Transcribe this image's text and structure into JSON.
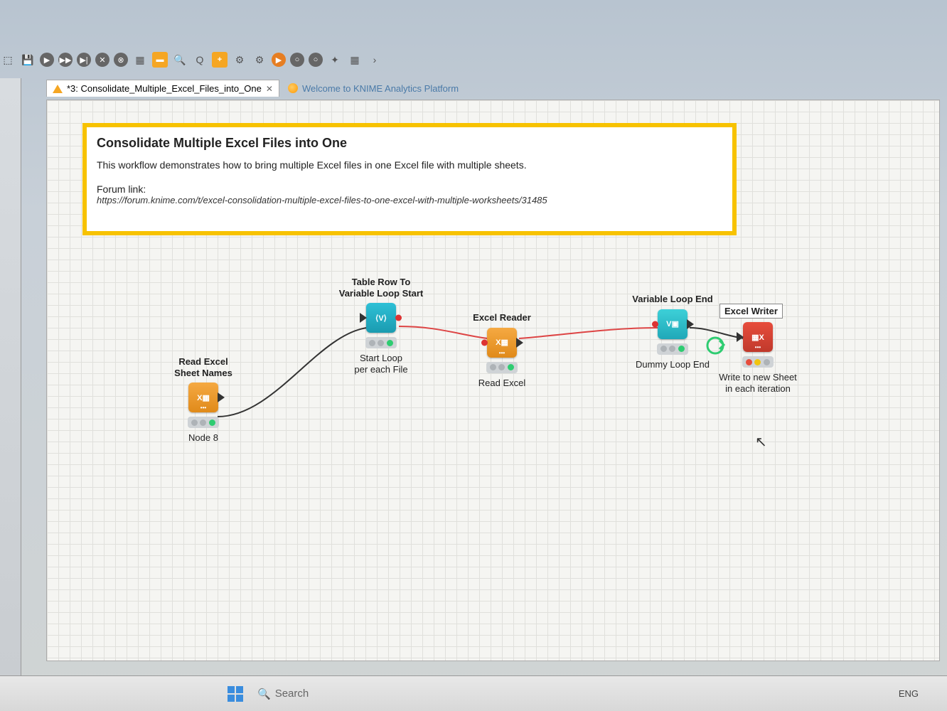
{
  "tabs": {
    "active": "*3: Consolidate_Multiple_Excel_Files_into_One",
    "inactive": "Welcome to KNIME Analytics Platform"
  },
  "annotation": {
    "title": "Consolidate Multiple Excel Files into One",
    "desc": "This workflow demonstrates how to bring multiple Excel files in one Excel file with multiple sheets.",
    "forum_label": "Forum link:",
    "forum_url": "https://forum.knime.com/t/excel-consolidation-multiple-excel-files-to-one-excel-with-multiple-worksheets/31485"
  },
  "free_label": {
    "excel_writer": "Excel Writer"
  },
  "nodes": {
    "read_excel_names": {
      "top_label": "Read Excel\nSheet Names",
      "bottom_label": "Node 8"
    },
    "loop_start": {
      "top_label": "Table Row To\nVariable Loop Start",
      "bottom_label": "Start Loop\nper each File"
    },
    "excel_reader": {
      "top_label": "Excel Reader",
      "bottom_label": "Read Excel"
    },
    "loop_end": {
      "top_label": "Variable Loop End",
      "bottom_label": "Dummy Loop End"
    },
    "excel_writer": {
      "bottom_label": "Write to new Sheet\nin each iteration"
    }
  },
  "taskbar": {
    "search": "Search",
    "lang": "ENG"
  }
}
